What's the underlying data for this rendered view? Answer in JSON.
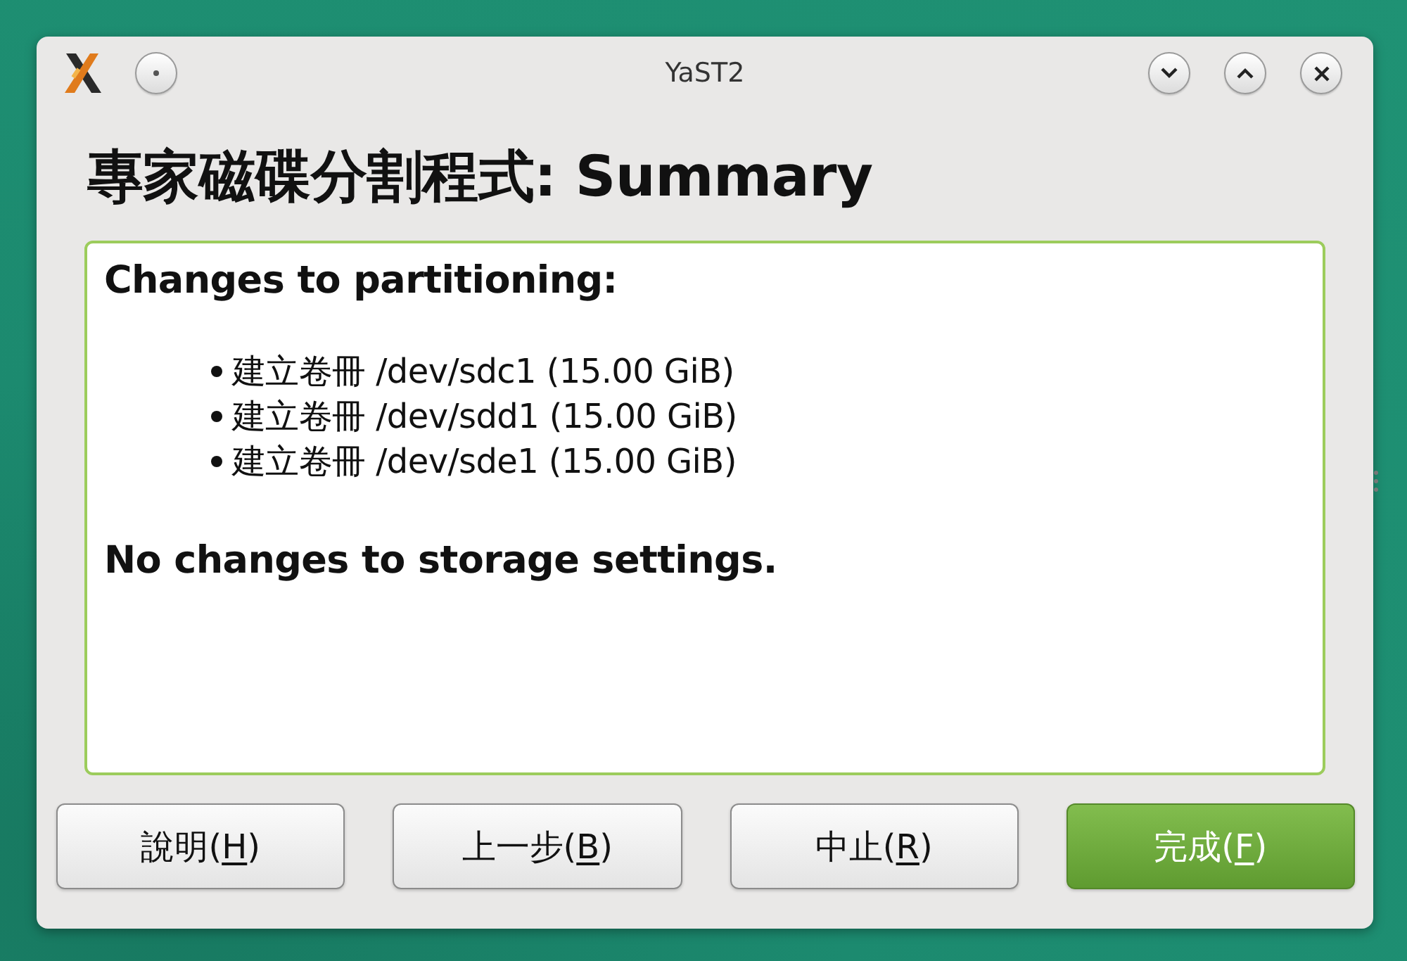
{
  "window": {
    "title": "YaST2"
  },
  "heading": "專家磁碟分割程式: Summary",
  "summary": {
    "sections": [
      {
        "kind": "heading",
        "text": "Changes to partitioning:"
      },
      {
        "kind": "list",
        "items": [
          "建立卷冊 /dev/sdc1 (15.00 GiB)",
          "建立卷冊 /dev/sdd1 (15.00 GiB)",
          "建立卷冊 /dev/sde1 (15.00 GiB)"
        ]
      },
      {
        "kind": "heading",
        "text": "No changes to storage settings."
      }
    ]
  },
  "buttons": [
    {
      "label_start": "說明(",
      "mnemonic": "H",
      "label_end": ")",
      "kind": "default"
    },
    {
      "label_start": "上一步(",
      "mnemonic": "B",
      "label_end": ")",
      "kind": "default"
    },
    {
      "label_start": "中止(",
      "mnemonic": "R",
      "label_end": ")",
      "kind": "default"
    },
    {
      "label_start": "完成(",
      "mnemonic": "F",
      "label_end": ")",
      "kind": "primary"
    }
  ]
}
